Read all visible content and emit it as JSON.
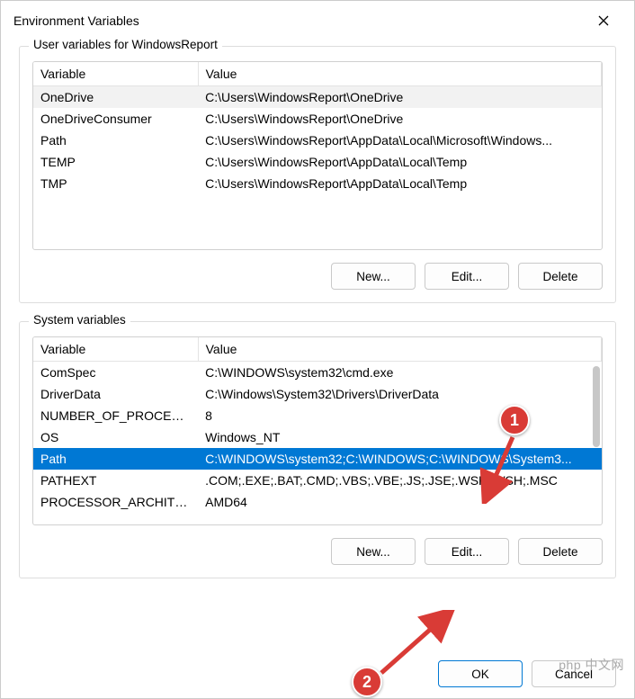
{
  "window": {
    "title": "Environment Variables"
  },
  "user_section": {
    "label": "User variables for WindowsReport",
    "columns": {
      "c0": "Variable",
      "c1": "Value"
    },
    "rows": [
      {
        "var": "OneDrive",
        "val": "C:\\Users\\WindowsReport\\OneDrive",
        "highlight": true
      },
      {
        "var": "OneDriveConsumer",
        "val": "C:\\Users\\WindowsReport\\OneDrive"
      },
      {
        "var": "Path",
        "val": "C:\\Users\\WindowsReport\\AppData\\Local\\Microsoft\\Windows..."
      },
      {
        "var": "TEMP",
        "val": "C:\\Users\\WindowsReport\\AppData\\Local\\Temp"
      },
      {
        "var": "TMP",
        "val": "C:\\Users\\WindowsReport\\AppData\\Local\\Temp"
      }
    ],
    "buttons": {
      "new": "New...",
      "edit": "Edit...",
      "delete": "Delete"
    }
  },
  "system_section": {
    "label": "System variables",
    "columns": {
      "c0": "Variable",
      "c1": "Value"
    },
    "rows": [
      {
        "var": "ComSpec",
        "val": "C:\\WINDOWS\\system32\\cmd.exe"
      },
      {
        "var": "DriverData",
        "val": "C:\\Windows\\System32\\Drivers\\DriverData"
      },
      {
        "var": "NUMBER_OF_PROCESSORS",
        "val": "8"
      },
      {
        "var": "OS",
        "val": "Windows_NT"
      },
      {
        "var": "Path",
        "val": "C:\\WINDOWS\\system32;C:\\WINDOWS;C:\\WINDOWS\\System3...",
        "selected": true
      },
      {
        "var": "PATHEXT",
        "val": ".COM;.EXE;.BAT;.CMD;.VBS;.VBE;.JS;.JSE;.WSF;.WSH;.MSC"
      },
      {
        "var": "PROCESSOR_ARCHITECTU...",
        "val": "AMD64"
      }
    ],
    "buttons": {
      "new": "New...",
      "edit": "Edit...",
      "delete": "Delete"
    }
  },
  "footer": {
    "ok": "OK",
    "cancel": "Cancel"
  },
  "annotations": {
    "marker1": "1",
    "marker2": "2"
  },
  "watermark": "php 中文网"
}
